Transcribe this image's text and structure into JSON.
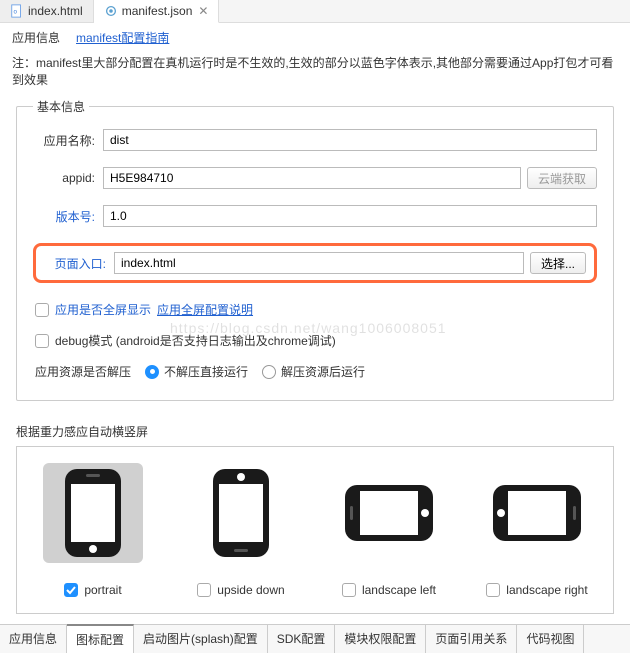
{
  "tabs": {
    "index": "index.html",
    "manifest": "manifest.json"
  },
  "subTabs": {
    "appInfo": "应用信息",
    "manifestGuide": "manifest配置指南"
  },
  "note": "注：manifest里大部分配置在真机运行时是不生效的,生效的部分以蓝色字体表示,其他部分需要通过App打包才可看到效果",
  "fieldset": {
    "legend": "基本信息",
    "appNameLabel": "应用名称:",
    "appNameValue": "dist",
    "appidLabel": "appid:",
    "appidValue": "H5E984710",
    "cloudBtn": "云端获取",
    "versionLabel": "版本号:",
    "versionValue": "1.0",
    "entryLabel": "页面入口:",
    "entryValue": "index.html",
    "selectBtn": "选择..."
  },
  "checks": {
    "fullscreenLabel": "应用是否全屏显示",
    "fullscreenLink": "应用全屏配置说明",
    "debugLabel": "debug模式 (android是否支持日志输出及chrome调试)"
  },
  "radio": {
    "label": "应用资源是否解压",
    "opt1": "不解压直接运行",
    "opt2": "解压资源后运行"
  },
  "orient": {
    "title": "根据重力感应自动横竖屏",
    "portrait": "portrait",
    "upsideDown": "upside down",
    "landscapeLeft": "landscape left",
    "landscapeRight": "landscape right"
  },
  "bottomTabs": {
    "t1": "应用信息",
    "t2": "图标配置",
    "t3": "启动图片(splash)配置",
    "t4": "SDK配置",
    "t5": "模块权限配置",
    "t6": "页面引用关系",
    "t7": "代码视图"
  },
  "watermark": "https://blog.csdn.net/wang1006008051"
}
